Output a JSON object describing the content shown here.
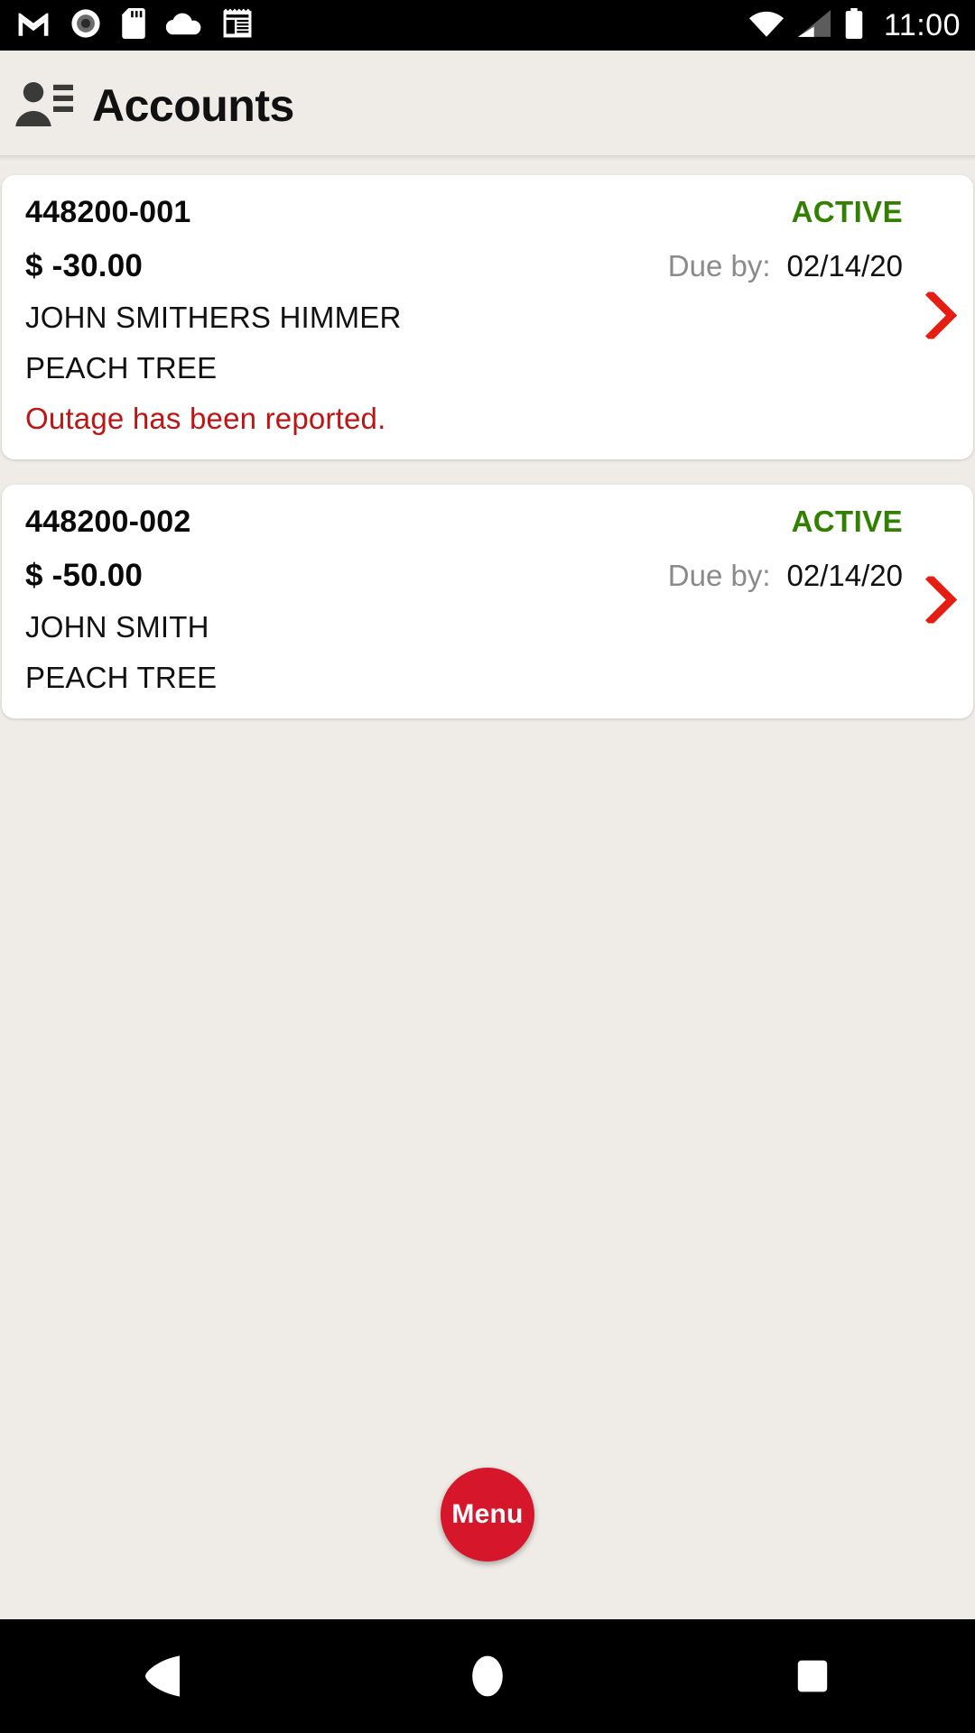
{
  "status_bar": {
    "icons_left": [
      "gmail-icon",
      "record-icon",
      "sd-card-icon",
      "cloud-icon",
      "news-icon"
    ],
    "icons_right": [
      "wifi-icon",
      "cellular-signal-icon",
      "battery-icon"
    ],
    "clock": "11:00"
  },
  "header": {
    "icon": "contacts-icon",
    "title": "Accounts"
  },
  "colors": {
    "page_bg": "#EFECE7",
    "card_bg": "#FFFFFF",
    "status_active": "#338000",
    "alert_red": "#BE1414",
    "chevron_red": "#E51E13",
    "fab_red": "#D6162B",
    "muted_gray": "#8A8A8A"
  },
  "accounts": [
    {
      "number": "448200-001",
      "status": "ACTIVE",
      "balance": "$ -30.00",
      "due_label": "Due by:",
      "due_date": "02/14/20",
      "customer_name": "JOHN SMITHERS HIMMER",
      "service_address": "PEACH TREE",
      "alert": "Outage has been reported.",
      "chevron": "chevron-right-icon"
    },
    {
      "number": "448200-002",
      "status": "ACTIVE",
      "balance": "$ -50.00",
      "due_label": "Due by:",
      "due_date": "02/14/20",
      "customer_name": "JOHN SMITH",
      "service_address": "PEACH TREE",
      "alert": "",
      "chevron": "chevron-right-icon"
    }
  ],
  "fab": {
    "label": "Menu"
  },
  "nav_bar": {
    "back": "back-triangle-icon",
    "home": "home-circle-icon",
    "recents": "recents-square-icon"
  }
}
